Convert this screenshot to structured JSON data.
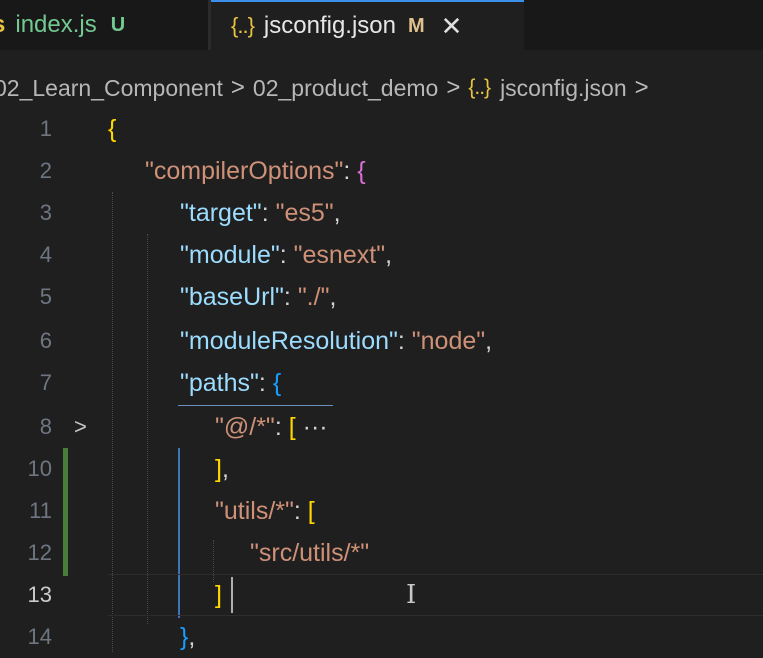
{
  "tabs": [
    {
      "icon": "JS",
      "name": "index.js",
      "status": "U"
    },
    {
      "icon": "{..}",
      "name": "jsconfig.json",
      "status": "M",
      "close": "✕"
    }
  ],
  "breadcrumb": {
    "items": [
      "02_Learn_Component",
      "02_product_demo",
      "jsconfig.json"
    ],
    "file_icon": "{..}",
    "separator": ">"
  },
  "editor": {
    "lines": [
      {
        "num": "1",
        "text": "{"
      },
      {
        "num": "2",
        "text": "\"compilerOptions\": {"
      },
      {
        "num": "3",
        "text": "\"target\": \"es5\","
      },
      {
        "num": "4",
        "text": "\"module\": \"esnext\","
      },
      {
        "num": "5",
        "text": "\"baseUrl\": \"./\","
      },
      {
        "num": "6",
        "text": "\"moduleResolution\": \"node\","
      },
      {
        "num": "7",
        "text": "\"paths\": {"
      },
      {
        "num": "8",
        "text": "\"@/*\": [ ···"
      },
      {
        "num": "10",
        "text": "],"
      },
      {
        "num": "11",
        "text": "\"utils/*\": ["
      },
      {
        "num": "12",
        "text": "\"src/utils/*\""
      },
      {
        "num": "13",
        "text": "]"
      },
      {
        "num": "14",
        "text": "},"
      }
    ],
    "active_line": "13",
    "folded_line": "8",
    "colors": {
      "key": "#9cdcfe",
      "string": "#ce9178",
      "bracket_level1": "#ffd700",
      "bracket_level2": "#da70d6",
      "bracket_level3": "#179fff",
      "git_modified": "#487e3a"
    }
  }
}
